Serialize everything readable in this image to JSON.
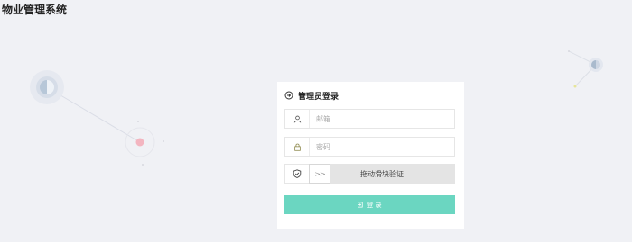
{
  "app": {
    "title": "物业管理系统"
  },
  "login": {
    "heading": "管理员登录",
    "email": {
      "placeholder": "邮箱",
      "value": ""
    },
    "password": {
      "placeholder": "密码",
      "value": ""
    },
    "slider": {
      "label": "拖动滑块验证",
      "handle_glyph": ">>"
    },
    "submit_label": "登 录"
  },
  "colors": {
    "background": "#f0f1f5",
    "accent": "#6bd6c1",
    "card": "#ffffff"
  },
  "icons": [
    "login-icon",
    "user-icon",
    "lock-icon",
    "shield-check-icon",
    "double-chevron-right-icon",
    "login-arrow-icon"
  ]
}
